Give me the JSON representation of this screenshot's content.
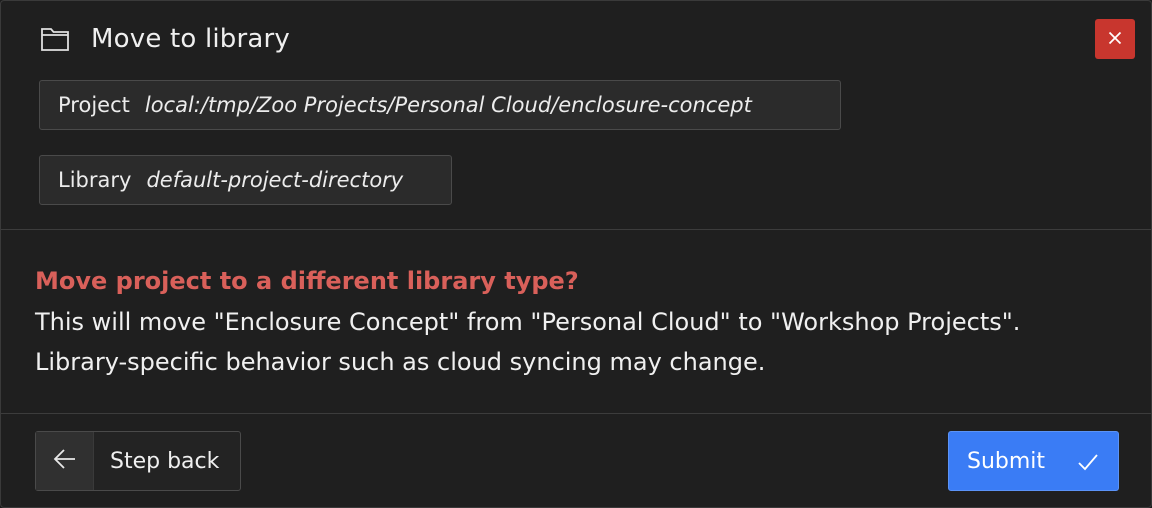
{
  "dialog": {
    "title": "Move to library",
    "icon": "folder-icon",
    "close_icon": "close-icon"
  },
  "fields": {
    "project": {
      "label": "Project",
      "value": "local:/tmp/Zoo Projects/Personal Cloud/enclosure-concept"
    },
    "library": {
      "label": "Library",
      "value": "default-project-directory"
    }
  },
  "warning": {
    "title": "Move project to a different library type?",
    "text": "This will move \"Enclosure Concept\" from \"Personal Cloud\" to \"Workshop Projects\". Library-specific behavior such as cloud syncing may change."
  },
  "footer": {
    "step_back_label": "Step back",
    "step_back_icon": "arrow-left-icon",
    "submit_label": "Submit",
    "submit_icon": "check-icon"
  },
  "colors": {
    "background": "#1f1f1f",
    "close_button": "#c8362e",
    "warning_title": "#d9605a",
    "submit_button": "#3a7cf5"
  }
}
